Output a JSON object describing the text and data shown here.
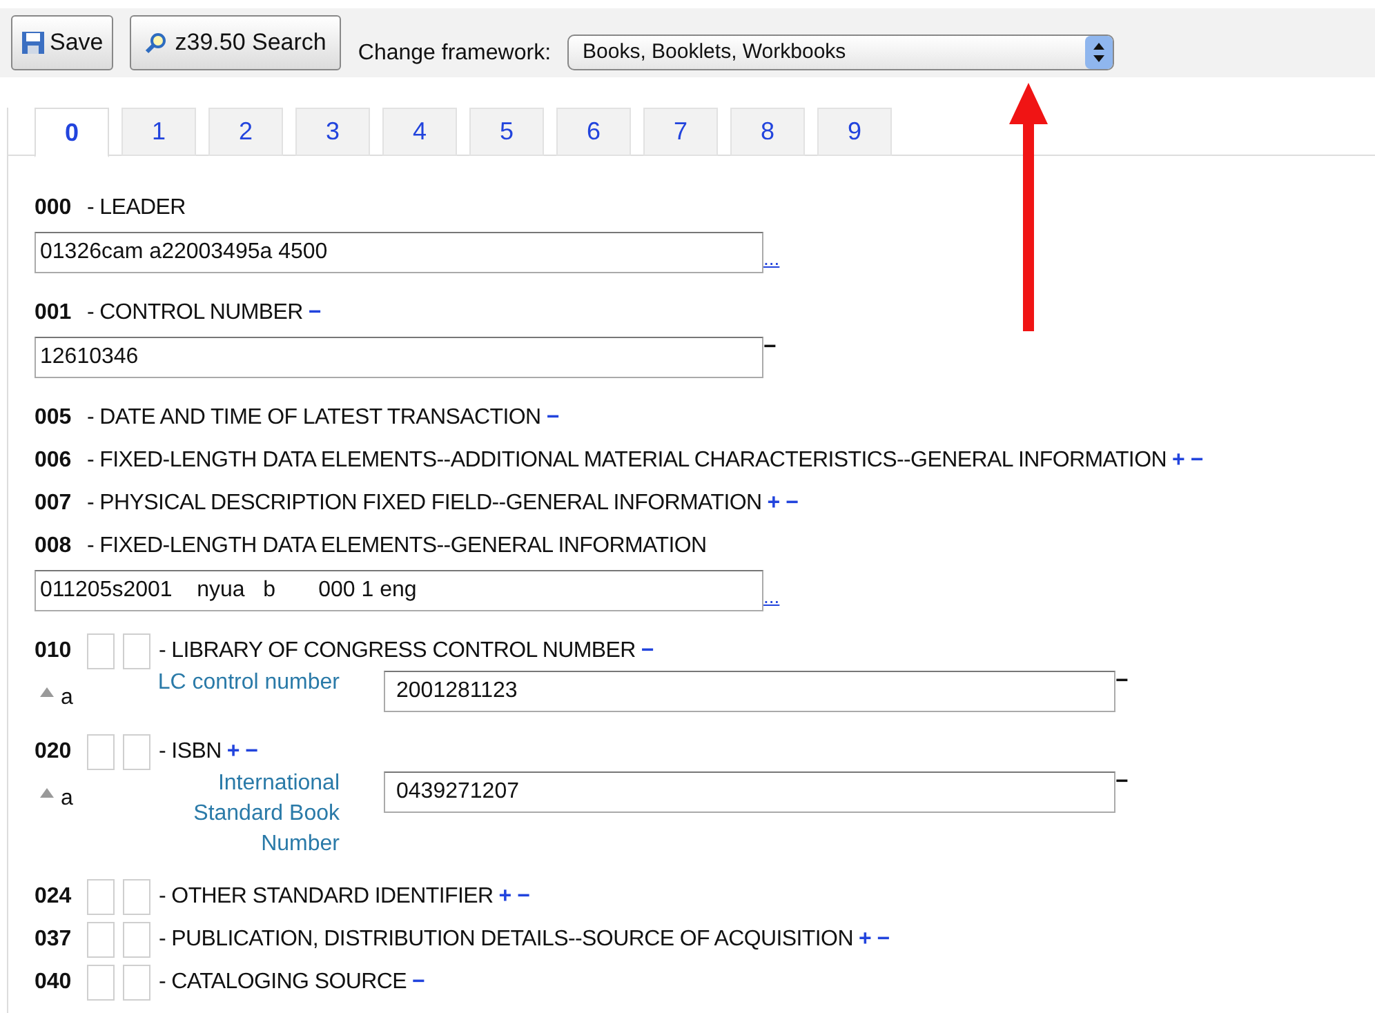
{
  "toolbar": {
    "save": "Save",
    "search": "z39.50 Search",
    "framework_label": "Change framework:",
    "framework_value": "Books, Booklets, Workbooks"
  },
  "tabs": [
    {
      "label": "0",
      "selected": true
    },
    {
      "label": "1",
      "selected": false
    },
    {
      "label": "2",
      "selected": false
    },
    {
      "label": "3",
      "selected": false
    },
    {
      "label": "4",
      "selected": false
    },
    {
      "label": "5",
      "selected": false
    },
    {
      "label": "6",
      "selected": false
    },
    {
      "label": "7",
      "selected": false
    },
    {
      "label": "8",
      "selected": false
    },
    {
      "label": "9",
      "selected": false
    }
  ],
  "fields": [
    {
      "tag": "000",
      "indicators": false,
      "name": "- LEADER",
      "value": "01326cam a22003495a 4500",
      "value_action": {
        "kind": "link",
        "text": "..."
      }
    },
    {
      "tag": "001",
      "indicators": false,
      "name": "- CONTROL NUMBER",
      "actions": [
        "−"
      ],
      "value": "12610346",
      "value_action": {
        "kind": "remove",
        "text": "−"
      }
    },
    {
      "tag": "005",
      "indicators": false,
      "name": "- DATE AND TIME OF LATEST TRANSACTION",
      "actions": [
        "−"
      ]
    },
    {
      "tag": "006",
      "indicators": false,
      "name": "- FIXED-LENGTH DATA ELEMENTS--ADDITIONAL MATERIAL CHARACTERISTICS--GENERAL INFORMATION",
      "actions": [
        "+",
        "−"
      ]
    },
    {
      "tag": "007",
      "indicators": false,
      "name": "- PHYSICAL DESCRIPTION FIXED FIELD--GENERAL INFORMATION",
      "actions": [
        "+",
        "−"
      ]
    },
    {
      "tag": "008",
      "indicators": false,
      "name": "- FIXED-LENGTH DATA ELEMENTS--GENERAL INFORMATION",
      "value": "011205s2001    nyua   b       000 1 eng",
      "value_action": {
        "kind": "link",
        "text": "..."
      }
    },
    {
      "tag": "010",
      "indicators": true,
      "name": "- LIBRARY OF CONGRESS CONTROL NUMBER",
      "actions": [
        "−"
      ],
      "subfields": [
        {
          "code": "a",
          "label": "LC control number",
          "value": "2001281123",
          "action": "−"
        }
      ]
    },
    {
      "tag": "020",
      "indicators": true,
      "name": "- ISBN",
      "actions": [
        "+",
        "−"
      ],
      "subfields": [
        {
          "code": "a",
          "label": "International Standard Book Number",
          "value": "0439271207",
          "action": "−"
        }
      ]
    },
    {
      "tag": "024",
      "indicators": true,
      "name": "- OTHER STANDARD IDENTIFIER",
      "actions": [
        "+",
        "−"
      ]
    },
    {
      "tag": "037",
      "indicators": true,
      "name": "- PUBLICATION, DISTRIBUTION DETAILS--SOURCE OF ACQUISITION",
      "actions": [
        "+",
        "−"
      ]
    },
    {
      "tag": "040",
      "indicators": true,
      "name": "- CATALOGING SOURCE",
      "actions": [
        "−"
      ]
    }
  ]
}
